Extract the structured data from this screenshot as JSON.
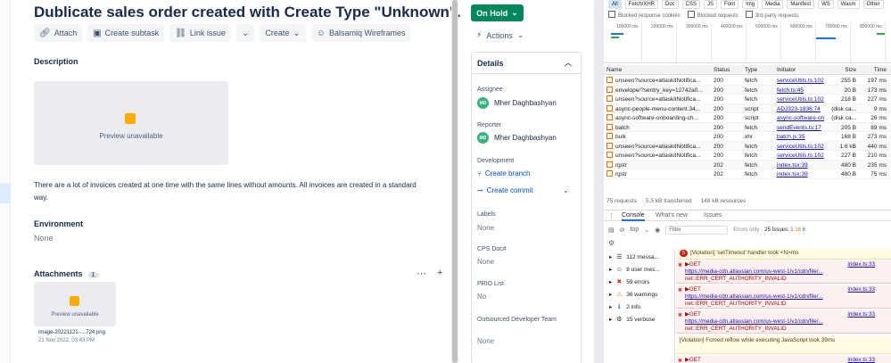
{
  "issue": {
    "title": "Dublicate sales order created with Create Type \"Unknown\".",
    "toolbar": {
      "attach": "Attach",
      "create_subtask": "Create subtask",
      "link_issue": "Link issue",
      "create": "Create",
      "balsamiq": "Balsamiq Wireframes"
    },
    "description_label": "Description",
    "preview_unavailable": "Preview unavailable",
    "description_text": "There are a lot of invoices created at one time with the same lines without amounts. All invoices are created in a standard way.",
    "environment_label": "Environment",
    "environment_value": "None",
    "attachments_label": "Attachments",
    "attachments_count": "1",
    "attachment": {
      "preview": "Preview unavailable",
      "name": "image-20221121-....724.png",
      "date": "21 Nov 2022, 03:43 PM"
    }
  },
  "sidebar": {
    "status": "On Hold",
    "actions": "Actions",
    "details": "Details",
    "assignee_label": "Assignee",
    "assignee": "Mher Daghbashyan",
    "assignee_initials": "MD",
    "reporter_label": "Reporter",
    "reporter": "Mher Daghbashyan",
    "reporter_initials": "MD",
    "development_label": "Development",
    "create_branch": "Create branch",
    "create_commit": "Create commit",
    "labels_label": "Labels",
    "labels_value": "None",
    "cps_label": "CPS Doc#",
    "cps_value": "None",
    "prio_label": "PRIO List",
    "prio_value": "No",
    "outsourced_label": "Outsourced Developer Team",
    "outsourced_value": "None"
  },
  "devtools": {
    "filters": [
      "All",
      "Fetch/XHR",
      "Doc",
      "CSS",
      "JS",
      "Font",
      "Img",
      "Media",
      "Manifest",
      "WS",
      "Wasm",
      "Other"
    ],
    "checks": [
      "Blocked response cookies",
      "Blocked requests",
      "3rd-party requests"
    ],
    "timeline_ticks": [
      "100000 ms",
      "200000 ms",
      "300000 ms",
      "400000 ms",
      "500000 ms",
      "600000 ms",
      "700000 ms",
      "800000 ms"
    ],
    "columns": {
      "name": "Name",
      "status": "Status",
      "type": "Type",
      "initiator": "Initiator",
      "size": "Size",
      "time": "Time"
    },
    "rows": [
      {
        "name": "unseen?source=atlaskitNotifica...",
        "status": "200",
        "type": "fetch",
        "initiator": "serviceUtils.ts:102",
        "size": "255 B",
        "time": "197 ms"
      },
      {
        "name": "envelope/?sentry_key=12742a0...",
        "status": "200",
        "type": "fetch",
        "initiator": "fetch.ts:45",
        "size": "20 B",
        "time": "173 ms"
      },
      {
        "name": "unseen?source=atlaskitNotifica...",
        "status": "200",
        "type": "fetch",
        "initiator": "serviceUtils.ts:102",
        "size": "218 B",
        "time": "227 ms"
      },
      {
        "name": "async-people-menu-content.34...",
        "status": "200",
        "type": "script",
        "initiator": "ADJ323-1836:74",
        "size": "(disk ca...",
        "time": "9 ms"
      },
      {
        "name": "async-software-onboarding-ch...",
        "status": "200",
        "type": "script",
        "initiator": "async-software-on",
        "size": "(disk ca...",
        "time": "26 ms"
      },
      {
        "name": "batch",
        "status": "200",
        "type": "fetch",
        "initiator": "sendEvents.ts:17",
        "size": "205 B",
        "time": "89 ms"
      },
      {
        "name": "bulk",
        "status": "200",
        "type": "xhr",
        "initiator": "batch.js:35",
        "size": "168 B",
        "time": "273 ms"
      },
      {
        "name": "unseen?source=atlaskitNotifica...",
        "status": "200",
        "type": "fetch",
        "initiator": "serviceUtils.ts:102",
        "size": "1.6 kB",
        "time": "440 ms"
      },
      {
        "name": "unseen?source=atlaskitNotifica...",
        "status": "200",
        "type": "fetch",
        "initiator": "serviceUtils.ts:102",
        "size": "227 B",
        "time": "210 ms"
      },
      {
        "name": "rgstr",
        "status": "202",
        "type": "fetch",
        "initiator": "index.tsx:39",
        "size": "480 B",
        "time": "235 ms"
      },
      {
        "name": "rgstr",
        "status": "202",
        "type": "fetch",
        "initiator": "index.tsx:39",
        "size": "480 B",
        "time": "75 ms"
      }
    ],
    "summary": {
      "requests": "75 requests",
      "transferred": "5.5 kB transferred",
      "resources": "148 kB resources"
    },
    "console_tabs": [
      "Console",
      "What's new",
      "Issues"
    ],
    "context": "top",
    "filter_placeholder": "Filter",
    "levels": "Errors only",
    "issues_count": "25 Issues:",
    "issues_err": "1",
    "issues_warn": "18",
    "issues_info": "6",
    "sidebar": [
      {
        "icon": "list-icon",
        "glyph": "☰",
        "label": "112 messa..."
      },
      {
        "icon": "user-icon",
        "glyph": "☺",
        "label": "8 user mes..."
      },
      {
        "icon": "error-icon",
        "glyph": "✖",
        "label": "59 errors"
      },
      {
        "icon": "warning-icon",
        "glyph": "⚠",
        "label": "36 warnings"
      },
      {
        "icon": "info-icon",
        "glyph": "ℹ",
        "label": "2 info"
      },
      {
        "icon": "verbose-icon",
        "glyph": "⚙",
        "label": "15 verbose"
      }
    ],
    "messages": {
      "violation_count": "5",
      "violation1": "[Violation] 'setTimeout' handler took <N>ms",
      "get": "▶GET",
      "url": "https://media-cdn.atlassian.com/us-west-1/v1/cdn/file/...",
      "err": "net::ERR_CERT_AUTHORITY_INVALID",
      "src": "index.ts:33",
      "violation2": "[Violation] Forced reflow while executing JavaScript took 39ms"
    }
  }
}
